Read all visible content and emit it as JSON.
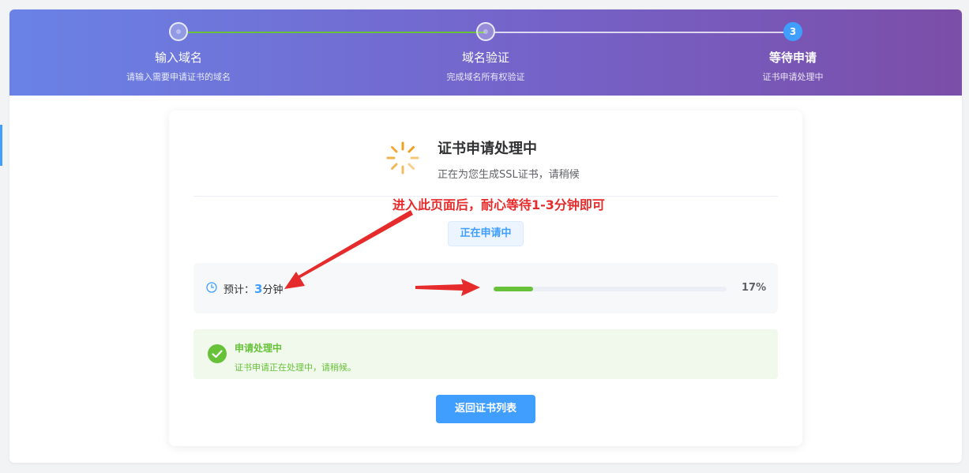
{
  "steps": [
    {
      "title": "输入域名",
      "desc": "请输入需要申请证书的域名",
      "state": "done"
    },
    {
      "title": "域名验证",
      "desc": "完成域名所有权验证",
      "state": "done"
    },
    {
      "title": "等待申请",
      "desc": "证书申请处理中",
      "state": "active",
      "number": "3"
    }
  ],
  "status": {
    "title": "证书申请处理中",
    "subtitle": "正在为您生成SSL证书，请稍候",
    "spinner_icon": "loading-spinner-icon",
    "spinner_color": "#f0a020"
  },
  "annotation": {
    "text": "进入此页面后，耐心等待1-3分钟即可",
    "color": "#e52b2b"
  },
  "tag": {
    "label": "正在申请中"
  },
  "progress": {
    "eta_label": "预计：",
    "eta_value": "3",
    "eta_unit": "分钟",
    "percent_text": "17%",
    "value": 0.17,
    "icon": "clock-icon",
    "fill_color": "#67c23a"
  },
  "alert": {
    "title": "申请处理中",
    "desc": "证书申请正在处理中，请稍候。",
    "icon": "check-circle-icon",
    "color": "#67c23a"
  },
  "actions": {
    "back_label": "返回证书列表"
  },
  "colors": {
    "primary": "#409eff",
    "success": "#67c23a"
  }
}
